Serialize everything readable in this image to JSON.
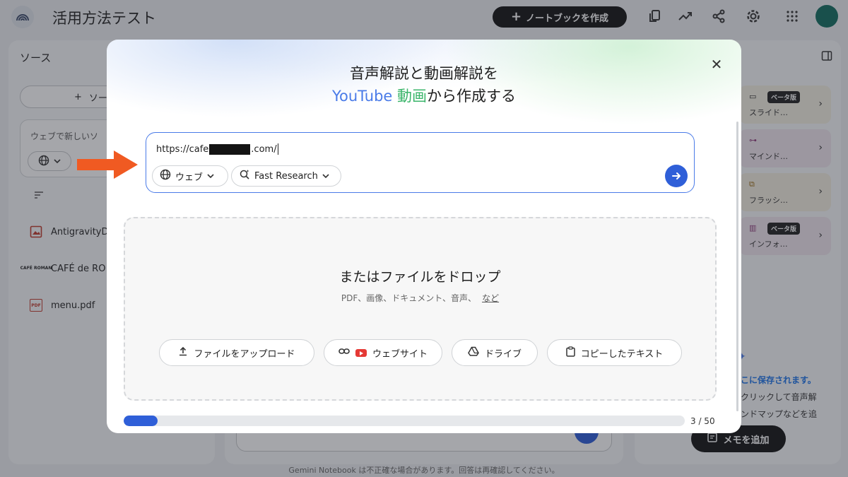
{
  "header": {
    "title": "活用方法テスト",
    "create_button": "ノートブックを作成",
    "icons": [
      "logo-icon",
      "copy-icon",
      "analytics-icon",
      "share-icon",
      "settings-icon",
      "apps-grid-icon",
      "avatar"
    ]
  },
  "sources_panel": {
    "title": "ソース",
    "add_button": "ソー",
    "web_search_prompt": "ウェブで新しいソ",
    "items": [
      {
        "label": "AntigravityD",
        "icon": "image-icon"
      },
      {
        "label": "CAFÉ de RO",
        "icon": "cafe-logo-icon",
        "icon_text": "CAFÉ ROMAN"
      },
      {
        "label": "menu.pdf",
        "icon": "pdf-icon",
        "icon_text": "PDF"
      }
    ]
  },
  "studio_panel": {
    "cards": [
      {
        "label": "スライド…",
        "badge": "ベータ版",
        "icon": "slides-icon",
        "color": "#f3efe2"
      },
      {
        "label": "マインド…",
        "badge": "",
        "icon": "mindmap-icon",
        "color": "#efe5ee"
      },
      {
        "label": "フラッシ…",
        "badge": "",
        "icon": "flashcard-icon",
        "color": "#f3eee0"
      },
      {
        "label": "インフォ…",
        "badge": "ベータ版",
        "icon": "infographic-icon",
        "color": "#efe5ee"
      }
    ],
    "note_line1": "こに保存されます。",
    "note_line2": "クリックして音声解",
    "note_line3": "ンドマップなどを追",
    "memo_button": "メモを追加"
  },
  "footer": {
    "disclaimer": "Gemini Notebook は不正確な場合があります。回答は再確認してください。"
  },
  "modal": {
    "title_line1": "音声解説と動画解説を",
    "title_youtube": "YouTube",
    "title_video": "動画",
    "title_rest": "から作成する",
    "url_prefix": "https://cafe",
    "url_suffix": ".com/",
    "web_pill": "ウェブ",
    "research_pill": "Fast Research",
    "drop_title": "またはファイルをドロップ",
    "drop_subtitle": "PDF、画像、ドキュメント、音声、",
    "drop_more_link": "など",
    "actions": {
      "upload": "ファイルをアップロード",
      "website": "ウェブサイト",
      "drive": "ドライブ",
      "copied_text": "コピーしたテキスト"
    },
    "progress": {
      "current": 3,
      "max": 50,
      "label": "3 / 50"
    }
  },
  "colors": {
    "accent": "#2f5fd8",
    "youtube_text": "#4a7be8",
    "video_text": "#3bb56b",
    "annotation_arrow": "#f05a22"
  }
}
